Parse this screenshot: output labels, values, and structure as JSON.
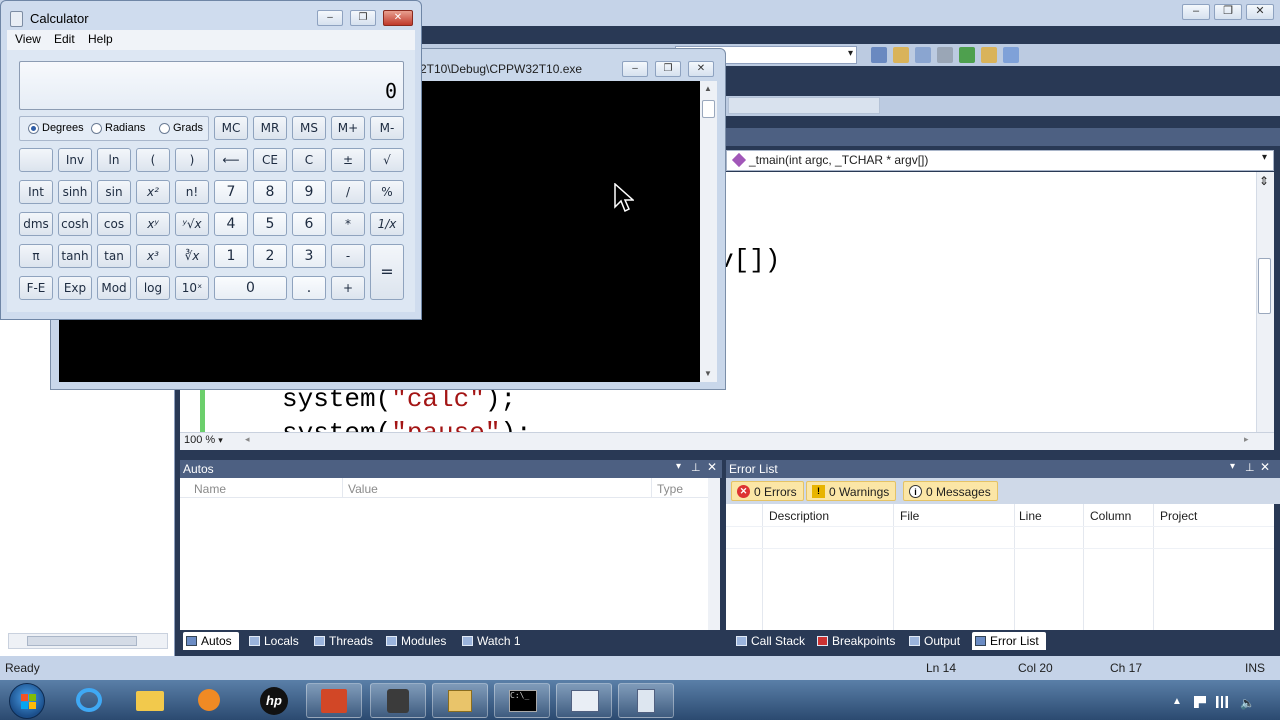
{
  "vs": {
    "editor_nav_func": "_tmain(int argc, _TCHAR * argv[])",
    "code_fragment_1": "v[])",
    "code_line_system_calc_prefix": "system(",
    "code_line_system_calc_str": "\"calc\"",
    "code_line_system_calc_suffix": ");",
    "code_line_system_pause_prefix": "system(",
    "code_line_system_pause_str": "\"pause\"",
    "code_line_system_pause_suffix": ");",
    "zoom": "100 %",
    "autos": {
      "title": "Autos",
      "columns": [
        "Name",
        "Value",
        "Type"
      ]
    },
    "error_list": {
      "title": "Error List",
      "errors_label": "0 Errors",
      "warnings_label": "0 Warnings",
      "messages_label": "0 Messages",
      "columns": [
        "Description",
        "File",
        "Line",
        "Column",
        "Project"
      ]
    },
    "left_tabs": [
      "Autos",
      "Locals",
      "Threads",
      "Modules",
      "Watch 1"
    ],
    "right_tabs": [
      "Call Stack",
      "Breakpoints",
      "Output",
      "Error List"
    ],
    "status": {
      "ready": "Ready",
      "ln": "Ln 14",
      "col": "Col 20",
      "ch": "Ch 17",
      "ins": "INS"
    }
  },
  "console": {
    "title": "2T10\\Debug\\CPPW32T10.exe"
  },
  "calc": {
    "title": "Calculator",
    "menu": [
      "View",
      "Edit",
      "Help"
    ],
    "display": "0",
    "angle_units": [
      "Degrees",
      "Radians",
      "Grads"
    ],
    "selected_angle": "Degrees",
    "memory": [
      "MC",
      "MR",
      "MS",
      "M+",
      "M-"
    ],
    "row2": [
      "",
      "Inv",
      "ln",
      "(",
      ")",
      "⟵",
      "CE",
      "C",
      "±",
      "√"
    ],
    "row3": [
      "Int",
      "sinh",
      "sin",
      "x²",
      "n!",
      "7",
      "8",
      "9",
      "/",
      "%"
    ],
    "row4": [
      "dms",
      "cosh",
      "cos",
      "xʸ",
      "ʸ√x",
      "4",
      "5",
      "6",
      "*",
      "1/x"
    ],
    "row5": [
      "π",
      "tanh",
      "tan",
      "x³",
      "∛x",
      "1",
      "2",
      "3",
      "-"
    ],
    "row6": [
      "F-E",
      "Exp",
      "Mod",
      "log",
      "10ˣ",
      "0",
      ".",
      "+"
    ],
    "equals": "="
  },
  "colors": {
    "vs_frame": "#293955",
    "vs_tab_active": "#fbe6a6",
    "console_bg": "#000000",
    "calc_bg": "#dde7f3"
  }
}
